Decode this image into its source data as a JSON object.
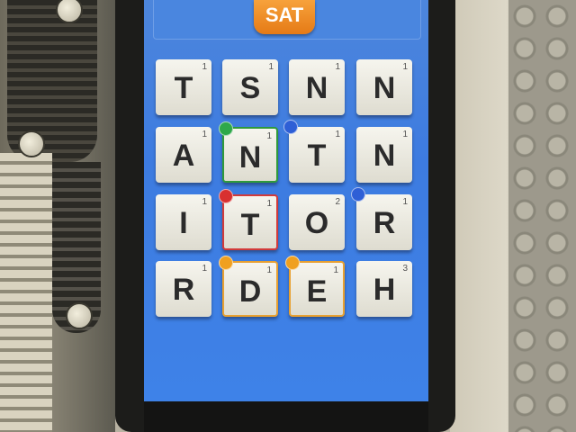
{
  "app": {
    "day_button": "SAT",
    "colors": {
      "screen": "#3d7be0",
      "day_button": "#f2911f",
      "tile": "#efede4"
    }
  },
  "board": {
    "rows": [
      [
        {
          "letter": "T",
          "score": "1",
          "badge": null
        },
        {
          "letter": "S",
          "score": "1",
          "badge": null
        },
        {
          "letter": "N",
          "score": "1",
          "badge": null
        },
        {
          "letter": "N",
          "score": "1",
          "badge": null
        }
      ],
      [
        {
          "letter": "A",
          "score": "1",
          "badge": null
        },
        {
          "letter": "N",
          "score": "1",
          "badge": "green",
          "highlight": "#2f9a3a"
        },
        {
          "letter": "T",
          "score": "1",
          "badge": "blue"
        },
        {
          "letter": "N",
          "score": "1",
          "badge": null
        }
      ],
      [
        {
          "letter": "I",
          "score": "1",
          "badge": null
        },
        {
          "letter": "T",
          "score": "1",
          "badge": "red",
          "highlight": "#d23a3a"
        },
        {
          "letter": "O",
          "score": "2",
          "badge": null
        },
        {
          "letter": "R",
          "score": "1",
          "badge": "blue"
        }
      ],
      [
        {
          "letter": "R",
          "score": "1",
          "badge": null
        },
        {
          "letter": "D",
          "score": "1",
          "badge": "orange",
          "highlight": "#e8a030"
        },
        {
          "letter": "E",
          "score": "1",
          "badge": "orange",
          "highlight": "#e8a030"
        },
        {
          "letter": "H",
          "score": "3",
          "badge": null
        }
      ]
    ],
    "badge_colors": {
      "green": "#2fa84a",
      "blue": "#2e5fd6",
      "red": "#d83030",
      "orange": "#f0a020"
    }
  }
}
